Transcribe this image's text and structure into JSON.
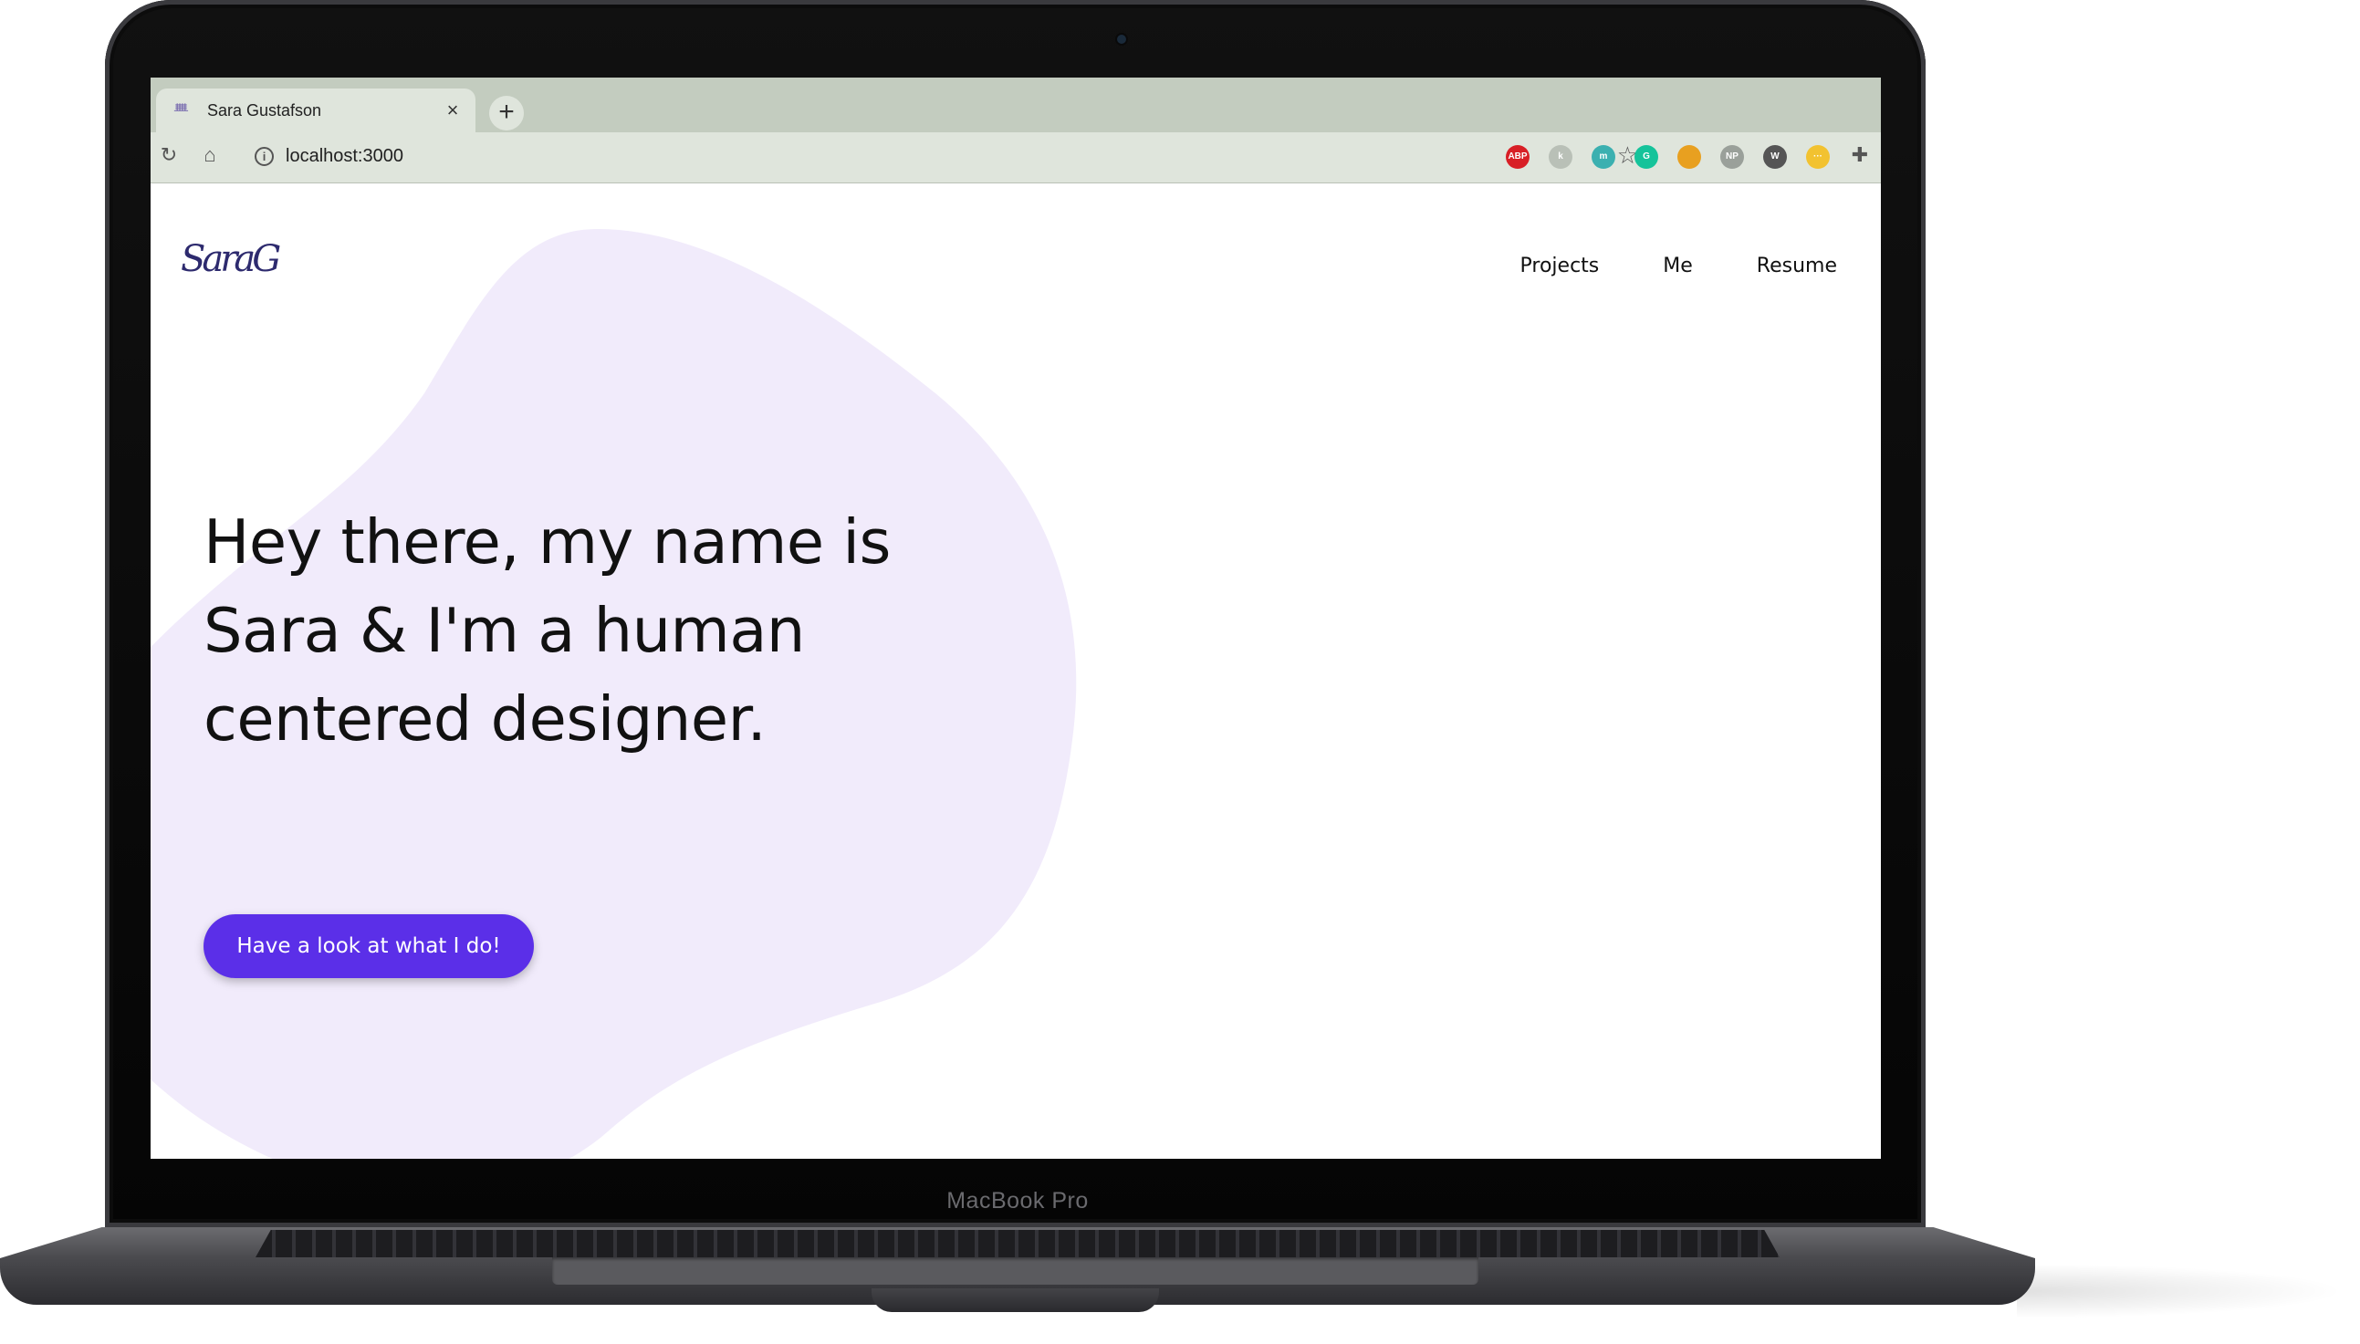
{
  "browser": {
    "tab_title": "Sara Gustafson",
    "url": "localhost:3000",
    "new_tab_label": "+",
    "close_label": "×",
    "extensions": [
      {
        "name": "adblock-plus-extension-icon",
        "label": "ABP",
        "color": "#d81f26"
      },
      {
        "name": "generic-extension-icon",
        "label": "k",
        "color": "#b9c0b7"
      },
      {
        "name": "m-extension-icon",
        "label": "m",
        "color": "#3bb0b0"
      },
      {
        "name": "grammarly-extension-icon",
        "label": "G",
        "color": "#15c39a"
      },
      {
        "name": "color-picker-extension-icon",
        "label": "",
        "color": "#e8a020"
      },
      {
        "name": "np-extension-icon",
        "label": "NP",
        "color": "#9aa09a"
      },
      {
        "name": "wordtune-extension-icon",
        "label": "W",
        "color": "#555555"
      },
      {
        "name": "ellipsis-extension-icon",
        "label": "···",
        "color": "#f2c230"
      }
    ]
  },
  "site": {
    "logo_text": "SaraG",
    "nav": [
      "Projects",
      "Me",
      "Resume"
    ],
    "headline": "Hey there, my name is Sara & I'm a human centered designer.",
    "cta_label": "Have a look at what I do!",
    "accent_color": "#5b2fe8",
    "blob_color": "#f1ebfb"
  },
  "device": {
    "label": "MacBook Pro"
  }
}
